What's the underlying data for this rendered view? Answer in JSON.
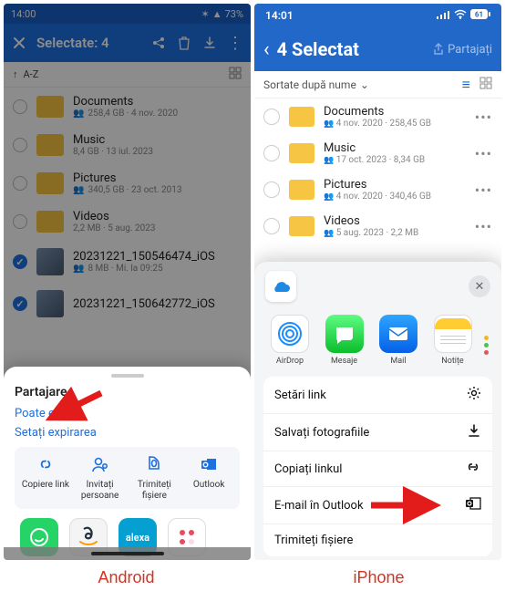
{
  "captions": {
    "android": "Android",
    "iphone": "iPhone"
  },
  "android": {
    "status": {
      "time": "14:00",
      "battery": "73%"
    },
    "topbar": {
      "title": "Selectate: 4"
    },
    "sortbar": {
      "label": "A-Z"
    },
    "files": [
      {
        "name": "Documents",
        "meta": "258,4 GB · 4 nov. 2020",
        "type": "folder",
        "shared": true,
        "selected": false
      },
      {
        "name": "Music",
        "meta": "8,4 GB · 13 iul. 2023",
        "type": "folder",
        "shared": false,
        "selected": false
      },
      {
        "name": "Pictures",
        "meta": "340,5 GB · 23 oct. 2013",
        "type": "folder",
        "shared": true,
        "selected": false
      },
      {
        "name": "Videos",
        "meta": "2,2 MB · 5 aug. 2023",
        "type": "folder",
        "shared": false,
        "selected": false
      },
      {
        "name": "20231221_150546474_iOS",
        "meta": "8 MB · Mi. la 09:25",
        "type": "image",
        "shared": true,
        "selected": true
      },
      {
        "name": "20231221_150642772_iOS",
        "meta": "",
        "type": "image",
        "shared": false,
        "selected": true
      }
    ],
    "sheet": {
      "title": "Partajare",
      "permission_label": "Poate edita",
      "expiry_label": "Setați expirarea",
      "actions": [
        {
          "id": "copy",
          "label": "Copiere link"
        },
        {
          "id": "invite",
          "label": "Invitați persoane"
        },
        {
          "id": "send",
          "label": "Trimiteți fișiere"
        },
        {
          "id": "outlook",
          "label": "Outlook"
        }
      ],
      "apps": [
        {
          "id": "whatsapp",
          "label": ""
        },
        {
          "id": "amazon",
          "label": ""
        },
        {
          "id": "alexa",
          "label": "alexa"
        },
        {
          "id": "generic",
          "label": ""
        }
      ]
    }
  },
  "iphone": {
    "status": {
      "time": "14:01"
    },
    "topbar": {
      "title": "4 Selectat",
      "share": "Partajați"
    },
    "sortbar": {
      "label": "Sortate după nume"
    },
    "files": [
      {
        "name": "Documents",
        "meta": "4 nov. 2020 · 258,45 GB"
      },
      {
        "name": "Music",
        "meta": "17 oct. 2023 · 8,34 GB"
      },
      {
        "name": "Pictures",
        "meta": "4 nov. 2020 · 340,46 GB"
      },
      {
        "name": "Videos",
        "meta": "5 aug. 2023 · 2,2 MB"
      }
    ],
    "sheet": {
      "apps": [
        {
          "id": "airdrop",
          "label": "AirDrop"
        },
        {
          "id": "mesaje",
          "label": "Mesaje"
        },
        {
          "id": "mail",
          "label": "Mail"
        },
        {
          "id": "notite",
          "label": "Notițe"
        }
      ],
      "menu": [
        {
          "id": "settings",
          "label": "Setări link",
          "icon": "gear"
        },
        {
          "id": "save",
          "label": "Salvați fotografiile",
          "icon": "download"
        },
        {
          "id": "copy",
          "label": "Copiați linkul",
          "icon": "link"
        },
        {
          "id": "eoutlook",
          "label": "E-mail în Outlook",
          "icon": "outlook"
        },
        {
          "id": "send",
          "label": "Trimiteți fișiere",
          "icon": ""
        }
      ]
    }
  }
}
